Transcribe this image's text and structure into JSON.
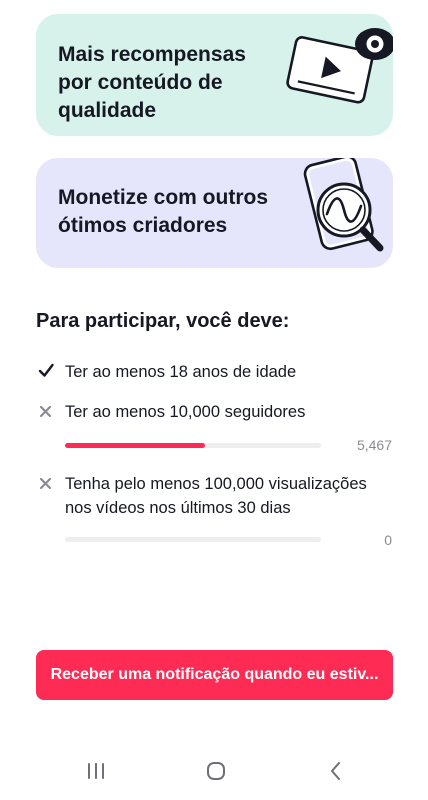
{
  "cards": [
    {
      "title": "Mais recompensas\npor conteúdo de\nqualidade",
      "icon": "video-eye-icon",
      "background": "#d6f2ea"
    },
    {
      "title": "Monetize com outros\nótimos criadores",
      "icon": "phone-magnifier-icon",
      "background": "#e5e6fb"
    }
  ],
  "requirements": {
    "title": "Para participar, você deve:",
    "items": [
      {
        "text": "Ter ao menos 18 anos de idade",
        "status": "met",
        "icon": "check-icon"
      },
      {
        "text": "Ter ao menos 10,000 seguidores",
        "status": "unmet",
        "icon": "cross-icon",
        "progress_value": "5,467",
        "progress_fraction": 0.5467
      },
      {
        "text": "Tenha pelo menos 100,000 visualizações nos vídeos nos últimos 30 dias",
        "status": "unmet",
        "icon": "cross-icon",
        "progress_value": "0",
        "progress_fraction": 0
      }
    ]
  },
  "cta": {
    "label": "Receber uma notificação quando eu estiv..."
  },
  "navbar": {
    "icons": [
      "recent-apps-icon",
      "home-icon",
      "back-icon"
    ]
  },
  "colors": {
    "accent": "#fe2c55",
    "track": "#eeeef0"
  }
}
